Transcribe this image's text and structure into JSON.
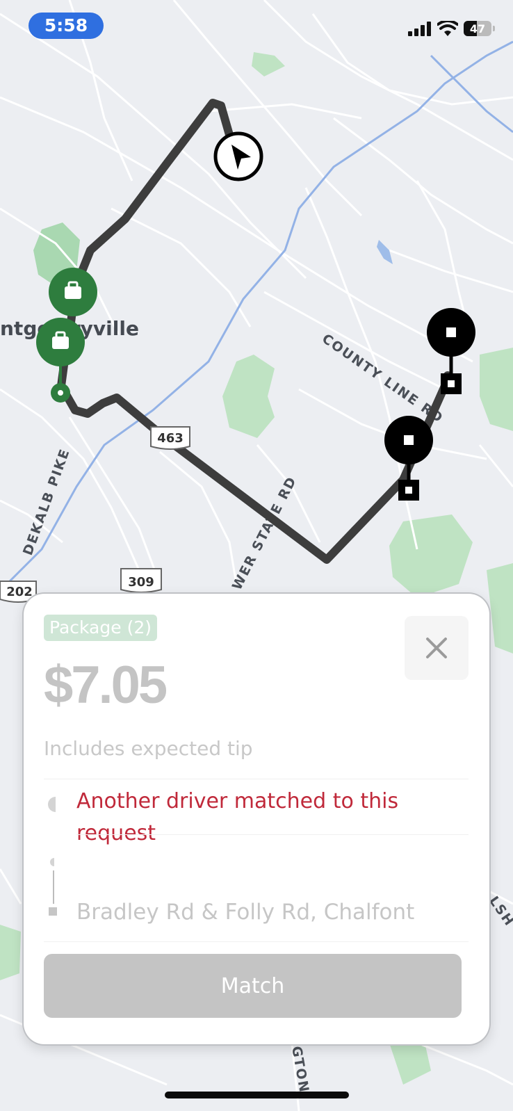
{
  "status_bar": {
    "time": "5:58",
    "battery_level": 47,
    "icons": [
      "cellular-signal-icon",
      "wifi-icon",
      "battery-icon"
    ]
  },
  "map": {
    "town_label": "ntgo   ryville",
    "road_labels": {
      "county_line": "COUNTY LINE RD",
      "dekalb": "DEKALB PIKE",
      "state_rd": "WER STATE RD",
      "right_edge": "LSH",
      "bottom": "GTON"
    },
    "shields": {
      "route_463": "463",
      "route_309": "309",
      "route_202": "202"
    },
    "colors": {
      "route": "#3d3d3d",
      "pickup": "#2e7d3e",
      "dropoff": "#000000",
      "water": "#8fb3e8",
      "park": "#bfe3c3"
    },
    "markers": [
      "navigation-arrow-icon",
      "pickup-bag-icon",
      "pickup-bag-icon",
      "dropoff-stop-icon",
      "dropoff-stop-icon"
    ]
  },
  "card": {
    "badge": "Package (2)",
    "price": "$7.05",
    "tip_note": "Includes expected tip",
    "alert": "Another driver matched to this request",
    "dropoff_address": "Bradley Rd & Folly Rd, Chalfont",
    "match_button": "Match",
    "close_icon": "close-icon"
  }
}
